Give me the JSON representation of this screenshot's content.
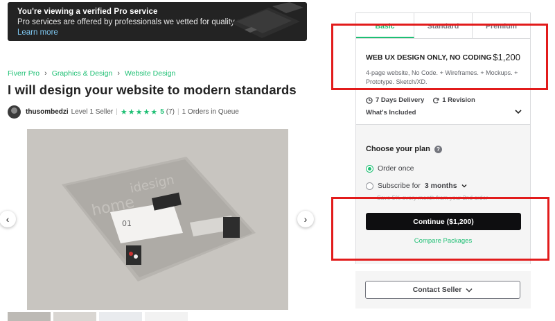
{
  "banner": {
    "title": "You're viewing a verified Pro service",
    "body": "Pro services are offered by professionals we vetted for quality and service.",
    "link": "Learn more"
  },
  "breadcrumb": [
    "Fiverr Pro",
    "Graphics & Design",
    "Website Design"
  ],
  "gig_title": "I will design your website to modern standards",
  "seller": {
    "name": "thusombedzi",
    "level": "Level 1 Seller",
    "stars": "★★★★★",
    "rating": "5",
    "reviews": "(7)",
    "queue": "1 Orders in Queue"
  },
  "gallery": {
    "prev_icon": "‹",
    "next_icon": "›",
    "mock_number": "01"
  },
  "packages": {
    "tabs": [
      "Basic",
      "Standard",
      "Premium"
    ],
    "active_tab": "Basic",
    "name": "WEB UX DESIGN ONLY, NO CODING",
    "price": "$1,200",
    "description": "4-page website, No Code. + Wireframes. + Mockups. + Prototype. Sketch/XD.",
    "delivery": "7 Days Delivery",
    "revisions": "1 Revision",
    "included": "What's Included"
  },
  "plan": {
    "heading": "Choose your plan",
    "option_once": "Order once",
    "option_subscribe": "Subscribe for",
    "subscribe_period": "3 months",
    "save_note": "Save 5% every month from your 2nd order",
    "continue_label": "Continue ($1,200)",
    "compare_label": "Compare Packages"
  },
  "contact": {
    "label": "Contact Seller"
  },
  "colors": {
    "accent": "#1dbf73",
    "annotation": "#e21b1b",
    "dark": "#0e0e10"
  }
}
